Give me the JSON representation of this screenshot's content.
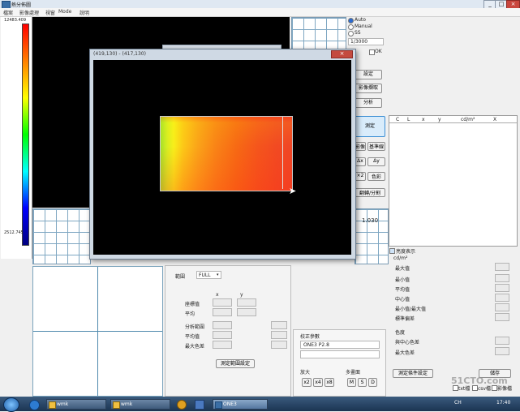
{
  "window": {
    "title": "熱分佈圖",
    "controls": [
      "_",
      "□",
      "×"
    ]
  },
  "menu": [
    "檔案",
    "影像處理",
    "視窗",
    "Mode",
    "說明"
  ],
  "colorbar": {
    "max_label": "12483.409",
    "min_label": "2512.745"
  },
  "scale_value": "1.030",
  "right_top": {
    "mode_options": [
      "Auto",
      "Manual",
      "SS"
    ],
    "selected_mode": "Auto",
    "exposure": "1/3000",
    "ok_label": "OK",
    "buttons": [
      "設定",
      "影像擷取",
      "分析"
    ],
    "measure_button": "測定",
    "small_buttons": [
      "影像",
      "基準線",
      "Δx",
      "Δy",
      "×2",
      "色彩",
      "翻轉/分割"
    ]
  },
  "data_table": {
    "headers": [
      "C",
      "L",
      "x",
      "y",
      "cd/m²",
      "X"
    ]
  },
  "stats": {
    "checkbox_label": "亮度表示",
    "unit": "cd/m²",
    "rows": [
      "最大值",
      "最小值",
      "平均值",
      "中心值",
      "最小值/最大值",
      "標準偏差"
    ],
    "color_title": "色度",
    "color_rows": [
      "與中心色差",
      "最大色差"
    ],
    "measure_settings_button": "測定條件設定",
    "save_button": "儲存",
    "export_checks": [
      "txt檔",
      "csv檔",
      "影像檔"
    ]
  },
  "range_panel": {
    "range_label": "範圍",
    "range_value": "FULL",
    "col_x": "x",
    "col_y": "y",
    "rows": [
      "座標值",
      "平均",
      "分析範圍",
      "平均值",
      "最大色差"
    ],
    "button": "測定範圍設定"
  },
  "correction_panel": {
    "title": "校正參數",
    "value": "ONE3 P2.8",
    "zoom_title": "放大",
    "zoom_buttons": [
      "x2",
      "x4",
      "x8"
    ],
    "multi_title": "多畫面",
    "multi_buttons": [
      "M",
      "S",
      "D"
    ]
  },
  "float_window": {
    "title": "(419,130) - (417,130)",
    "close": "×"
  },
  "taskbar": {
    "items": [
      "wmk",
      "wmk",
      "ONE3"
    ],
    "tray_text": "CH",
    "clock": "17:40"
  },
  "watermark": "51CTO.com"
}
